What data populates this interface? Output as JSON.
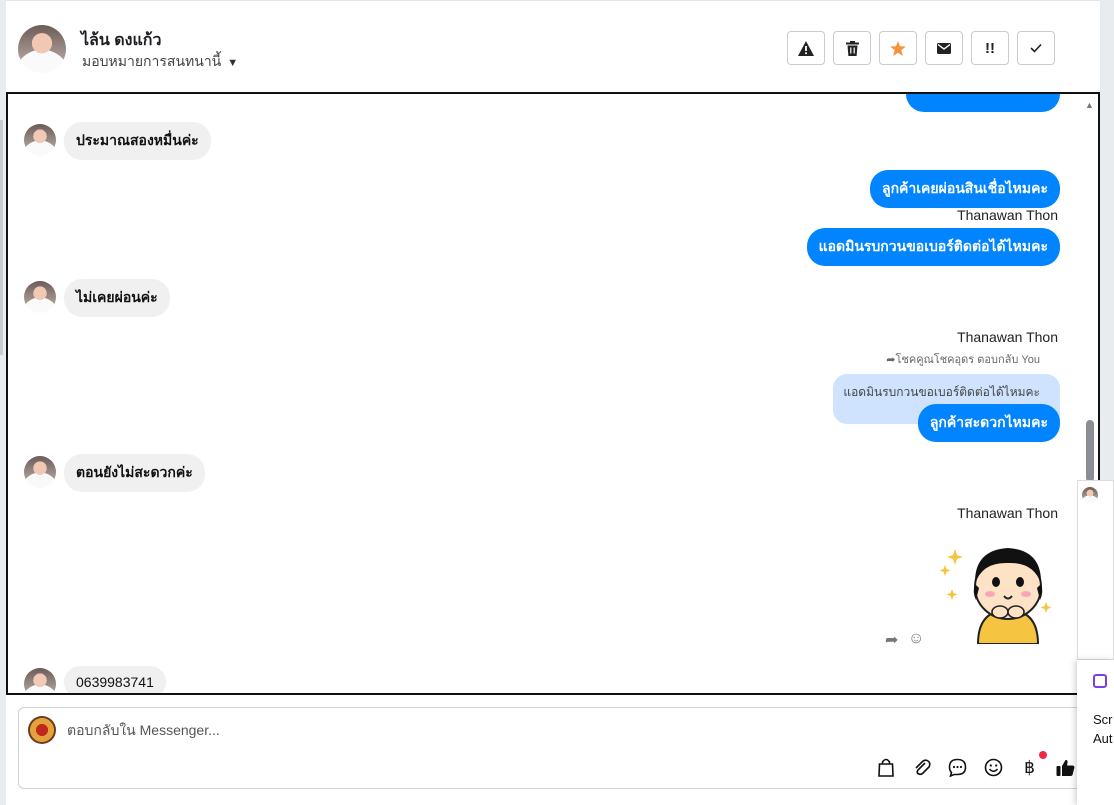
{
  "header": {
    "contact_name": "ไล้น ดงแก้ว",
    "assign_label": "มอบหมายการสนทนานี้",
    "toolbar": [
      {
        "name": "spam-button",
        "icon": "warning-icon"
      },
      {
        "name": "delete-button",
        "icon": "trash-icon"
      },
      {
        "name": "star-button",
        "icon": "star-icon",
        "color": "#f7923a"
      },
      {
        "name": "mark-unread-button",
        "icon": "envelope-icon"
      },
      {
        "name": "follow-up-button",
        "icon": "follow-up-icon"
      },
      {
        "name": "mark-done-button",
        "icon": "check-icon"
      }
    ]
  },
  "chat": {
    "messages": {
      "in_1": "ประมาณสองหมื่นค่ะ",
      "out_1": "ลูกค้าเคยผ่อนสินเชื่อไหมคะ",
      "sender_1": "Thanawan Thon",
      "out_2": "แอดมินรบกวนขอเบอร์ติดต่อได้ไหมคะ",
      "in_2": "ไม่เคยผ่อนค่ะ",
      "sender_2": "Thanawan Thon",
      "reply_note": "โชคคูณโชคอุดร ตอบกลับ You",
      "quoted": "แอดมินรบกวนขอเบอร์ติดต่อได้ไหมคะ",
      "out_3": "ลูกค้าสะดวกไหมคะ",
      "in_3": "ตอนยังไม่สะดวกค่ะ",
      "sender_3": "Thanawan Thon",
      "in_4": "0639983741"
    },
    "accent_color": "#0084ff"
  },
  "composer": {
    "placeholder": "ตอบกลับใน Messenger...",
    "tools": [
      "bag-icon",
      "attachment-icon",
      "chat-bubble-icon",
      "emoji-icon",
      "baht-icon",
      "thumbs-up-icon"
    ]
  },
  "popup": {
    "line1": "Scr",
    "line2": "Aut"
  }
}
